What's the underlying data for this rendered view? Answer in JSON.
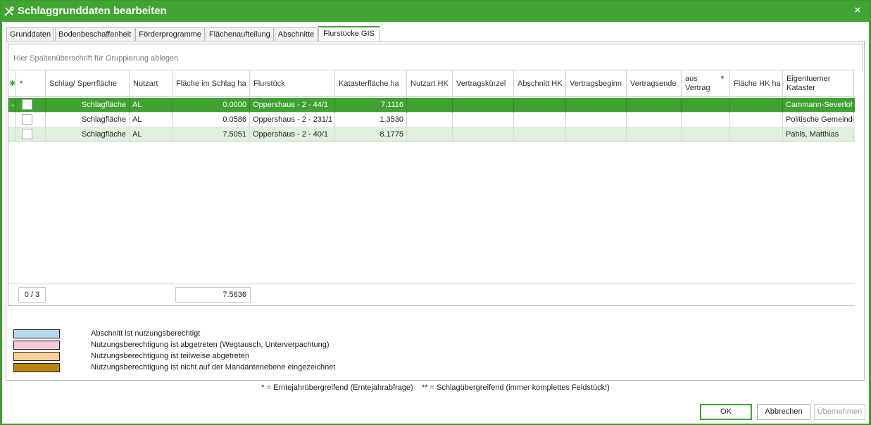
{
  "window": {
    "title": "Schlaggrunddaten bearbeiten",
    "close_glyph": "×",
    "icon": "tools-icon"
  },
  "tabs": [
    {
      "label": "Grunddaten",
      "active": false
    },
    {
      "label": "Bodenbeschaffenheit",
      "active": false
    },
    {
      "label": "Förderprogramme",
      "active": false
    },
    {
      "label": "Flächenaufteilung",
      "active": false
    },
    {
      "label": "Abschnitte",
      "active": false
    },
    {
      "label": "Flurstücke GIS",
      "active": true
    }
  ],
  "grid": {
    "group_hint": "Hier Spaltenüberschrift für Gruppierung ablegen",
    "indicator_glyph": "✱",
    "row_arrow_glyph": "→",
    "columns": [
      "*",
      "Schlag/ Sperrfläche",
      "Nutzart",
      "Fläche im Schlag ha",
      "Flurstück",
      "Katasterfläche ha",
      "Nutzart HK",
      "Vertragskürzel",
      "Abschnitt HK",
      "Vertragsbeginn",
      "Vertragsende",
      "aus Vertrag",
      "Fläche HK ha",
      "Eigentuemer Kataster"
    ],
    "rows": [
      {
        "selected": true,
        "cells": [
          "",
          "Schlagfläche",
          "AL",
          "0.0000",
          "Oppershaus - 2 - 44/1",
          "7.1116",
          "",
          "",
          "",
          "",
          "",
          "",
          "",
          "Cammann-Severloh"
        ]
      },
      {
        "selected": false,
        "cells": [
          "",
          "Schlagfläche",
          "AL",
          "0.0586",
          "Oppershaus - 2 - 231/1",
          "1.3530",
          "",
          "",
          "",
          "",
          "",
          "",
          "",
          "Politische Gemeinde"
        ]
      },
      {
        "selected": false,
        "cells": [
          "",
          "Schlagfläche",
          "AL",
          "7.5051",
          "Oppershaus - 2 - 40/1",
          "8.1775",
          "",
          "",
          "",
          "",
          "",
          "",
          "",
          "Pahls, Matthias"
        ]
      }
    ],
    "footer": {
      "count": "0 / 3",
      "sum_flaeche": "7.5636"
    }
  },
  "legend": [
    {
      "color": "#b4d9ee",
      "label": "Abschnitt ist nutzungsberechtigt"
    },
    {
      "color": "#f7c6d9",
      "label": "Nutzungsberechtigung ist abgetreten (Wegtausch, Unterverpachtung)"
    },
    {
      "color": "#fcd09b",
      "label": "Nutzungsberechtigung ist teilweise abgetreten"
    },
    {
      "color": "#b8860b",
      "label": "Nutzungsberechtigung ist nicht auf der Mandantenebene eingezeichnet"
    }
  ],
  "note": "* = Erntejahrübergreifend (Erntejahrabfrage)    ** = Schlagübergreifend (immer komplettes Feldstück!)",
  "buttons": {
    "ok": "OK",
    "cancel": "Abbrechen",
    "apply": "Übernehmen"
  },
  "colors": {
    "accent": "#3fa231",
    "row_alt": "#dff1db"
  }
}
